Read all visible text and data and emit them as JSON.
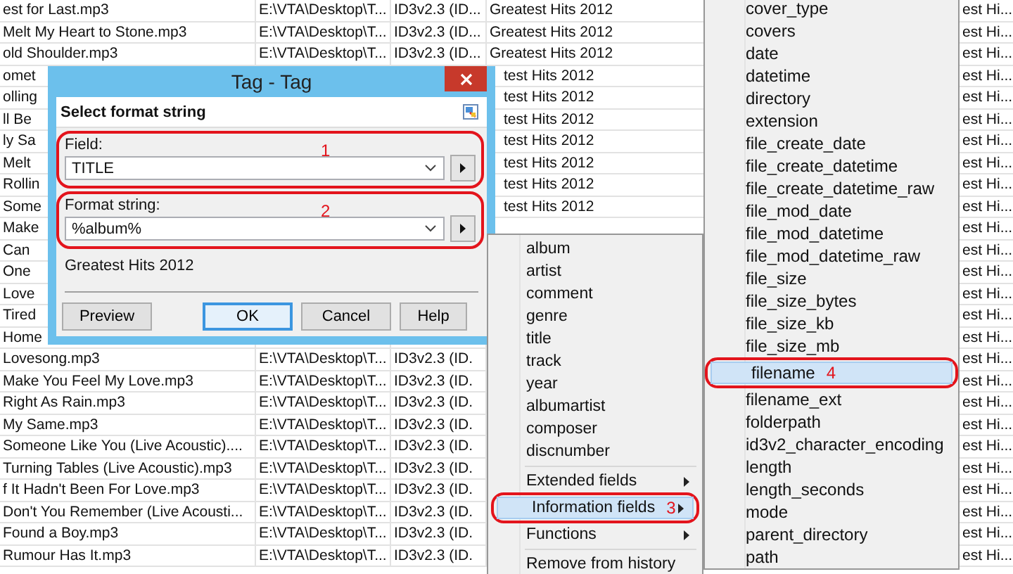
{
  "table": {
    "rows": [
      {
        "name": "est for Last.mp3",
        "path": "E:\\VTA\\Desktop\\T...",
        "tag": "ID3v2.3 (ID...",
        "album": "Greatest Hits 2012",
        "column_5": "est Hi..."
      },
      {
        "name": "Melt My Heart to Stone.mp3",
        "path": "E:\\VTA\\Desktop\\T...",
        "tag": "ID3v2.3 (ID...",
        "album": "Greatest Hits 2012",
        "column_5": "est Hi..."
      },
      {
        "name": "old Shoulder.mp3",
        "path": "E:\\VTA\\Desktop\\T...",
        "tag": "ID3v2.3 (ID...",
        "album": "Greatest Hits 2012",
        "column_5": "est Hi..."
      },
      {
        "name": "omet",
        "album": "test Hits 2012",
        "column_5": "est Hi..."
      },
      {
        "name": "olling",
        "album": "test Hits 2012",
        "column_5": "est Hi..."
      },
      {
        "name": "ll Be",
        "album": "test Hits 2012",
        "column_5": "est Hi..."
      },
      {
        "name": "ly Sa",
        "album": "test Hits 2012",
        "column_5": "est Hi..."
      },
      {
        "name": "Melt",
        "album": "test Hits 2012",
        "column_5": "est Hi..."
      },
      {
        "name": "Rollin",
        "album": "test Hits 2012",
        "column_5": "est Hi..."
      },
      {
        "name": "Some",
        "album": "test Hits 2012",
        "column_5": "est Hi..."
      },
      {
        "name": "Make",
        "column_5": "est Hi..."
      },
      {
        "name": "Can",
        "column_5": "est Hi..."
      },
      {
        "name": "One",
        "column_5": "est Hi..."
      },
      {
        "name": "Love",
        "column_5": "est Hi..."
      },
      {
        "name": "Tired",
        "column_5": "est Hi..."
      },
      {
        "name": "Home",
        "column_5": "est Hi..."
      },
      {
        "name": "Lovesong.mp3",
        "path": "E:\\VTA\\Desktop\\T...",
        "tag": "ID3v2.3 (ID.",
        "column_5": "est Hi..."
      },
      {
        "name": "Make You Feel My Love.mp3",
        "path": "E:\\VTA\\Desktop\\T...",
        "tag": "ID3v2.3 (ID.",
        "column_5": "est Hi..."
      },
      {
        "name": "Right As Rain.mp3",
        "path": "E:\\VTA\\Desktop\\T...",
        "tag": "ID3v2.3 (ID.",
        "column_5": "est Hi..."
      },
      {
        "name": "My Same.mp3",
        "path": "E:\\VTA\\Desktop\\T...",
        "tag": "ID3v2.3 (ID.",
        "column_5": "est Hi..."
      },
      {
        "name": "Someone Like You (Live Acoustic)....",
        "path": "E:\\VTA\\Desktop\\T...",
        "tag": "ID3v2.3 (ID.",
        "column_5": "est Hi..."
      },
      {
        "name": "Turning Tables (Live Acoustic).mp3",
        "path": "E:\\VTA\\Desktop\\T...",
        "tag": "ID3v2.3 (ID.",
        "column_5": "est Hi..."
      },
      {
        "name": "f It Hadn't Been For Love.mp3",
        "path": "E:\\VTA\\Desktop\\T...",
        "tag": "ID3v2.3 (ID.",
        "column_5": "est Hi..."
      },
      {
        "name": "Don't You Remember (Live Acousti...",
        "path": "E:\\VTA\\Desktop\\T...",
        "tag": "ID3v2.3 (ID.",
        "column_5": "est Hi..."
      },
      {
        "name": "Found a Boy.mp3",
        "path": "E:\\VTA\\Desktop\\T...",
        "tag": "ID3v2.3 (ID.",
        "column_5": "est Hi..."
      },
      {
        "name": "Rumour Has It.mp3",
        "path": "E:\\VTA\\Desktop\\T...",
        "tag": "ID3v2.3 (ID.",
        "column_5": "est Hi..."
      }
    ]
  },
  "dialog": {
    "title": "Tag - Tag",
    "header": "Select format string",
    "groups": [
      {
        "label": "Field:",
        "value": "TITLE",
        "annotation": "1"
      },
      {
        "label": "Format string:",
        "value": "%album%",
        "annotation": "2"
      }
    ],
    "preview_text": "Greatest Hits 2012",
    "buttons": [
      {
        "label": "Preview",
        "default": false
      },
      {
        "label": "OK",
        "default": true
      },
      {
        "label": "Cancel",
        "default": false
      },
      {
        "label": "Help",
        "default": false
      }
    ]
  },
  "menu": {
    "items": [
      {
        "kind": "item",
        "label": "album",
        "submenu": false,
        "selected": false
      },
      {
        "kind": "item",
        "label": "artist",
        "submenu": false,
        "selected": false
      },
      {
        "kind": "item",
        "label": "comment",
        "submenu": false,
        "selected": false
      },
      {
        "kind": "item",
        "label": "genre",
        "submenu": false,
        "selected": false
      },
      {
        "kind": "item",
        "label": "title",
        "submenu": false,
        "selected": false
      },
      {
        "kind": "item",
        "label": "track",
        "submenu": false,
        "selected": false
      },
      {
        "kind": "item",
        "label": "year",
        "submenu": false,
        "selected": false
      },
      {
        "kind": "item",
        "label": "albumartist",
        "submenu": false,
        "selected": false
      },
      {
        "kind": "item",
        "label": "composer",
        "submenu": false,
        "selected": false
      },
      {
        "kind": "item",
        "label": "discnumber",
        "submenu": false,
        "selected": false
      },
      {
        "kind": "separator"
      },
      {
        "kind": "item",
        "label": "Extended fields",
        "submenu": true,
        "selected": false
      },
      {
        "kind": "item",
        "label": "Information fields",
        "submenu": true,
        "selected": true,
        "annotation": "3"
      },
      {
        "kind": "item",
        "label": "Functions",
        "submenu": true,
        "selected": false
      },
      {
        "kind": "separator"
      },
      {
        "kind": "item",
        "label": "Remove from history",
        "submenu": false,
        "selected": false
      }
    ]
  },
  "submenu": {
    "items": [
      {
        "label": "cover_type",
        "selected": false
      },
      {
        "label": "covers",
        "selected": false
      },
      {
        "label": "date",
        "selected": false
      },
      {
        "label": "datetime",
        "selected": false
      },
      {
        "label": "directory",
        "selected": false
      },
      {
        "label": "extension",
        "selected": false
      },
      {
        "label": "file_create_date",
        "selected": false
      },
      {
        "label": "file_create_datetime",
        "selected": false
      },
      {
        "label": "file_create_datetime_raw",
        "selected": false
      },
      {
        "label": "file_mod_date",
        "selected": false
      },
      {
        "label": "file_mod_datetime",
        "selected": false
      },
      {
        "label": "file_mod_datetime_raw",
        "selected": false
      },
      {
        "label": "file_size",
        "selected": false
      },
      {
        "label": "file_size_bytes",
        "selected": false
      },
      {
        "label": "file_size_kb",
        "selected": false
      },
      {
        "label": "file_size_mb",
        "selected": false
      },
      {
        "label": "filename",
        "selected": true,
        "annotation": "4"
      },
      {
        "label": "filename_ext",
        "selected": false
      },
      {
        "label": "folderpath",
        "selected": false
      },
      {
        "label": "id3v2_character_encoding",
        "selected": false
      },
      {
        "label": "length",
        "selected": false
      },
      {
        "label": "length_seconds",
        "selected": false
      },
      {
        "label": "mode",
        "selected": false
      },
      {
        "label": "parent_directory",
        "selected": false
      },
      {
        "label": "path",
        "selected": false
      }
    ]
  }
}
